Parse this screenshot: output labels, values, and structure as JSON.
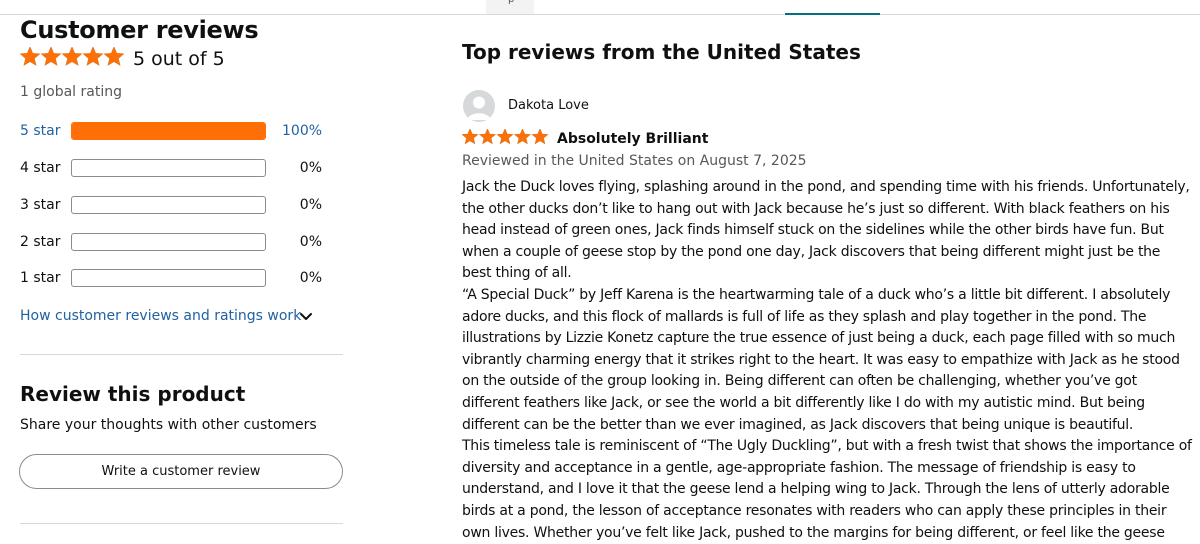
{
  "top_tabs": {
    "left_tab_label": "p"
  },
  "summary": {
    "title": "Customer reviews",
    "rating_value": 5,
    "rating_text": "5 out of 5",
    "total_ratings": "1 global rating",
    "histogram": [
      {
        "label": "5 star",
        "percent_text": "100%",
        "fraction": 1.0
      },
      {
        "label": "4 star",
        "percent_text": "0%",
        "fraction": 0
      },
      {
        "label": "3 star",
        "percent_text": "0%",
        "fraction": 0
      },
      {
        "label": "2 star",
        "percent_text": "0%",
        "fraction": 0
      },
      {
        "label": "1 star",
        "percent_text": "0%",
        "fraction": 0
      }
    ],
    "how_link": "How customer reviews and ratings work"
  },
  "review_product": {
    "title": "Review this product",
    "subtitle": "Share your thoughts with other customers",
    "button_label": "Write a customer review"
  },
  "top_reviews": {
    "heading": "Top reviews from the United States",
    "reviews": [
      {
        "reviewer": "Dakota Love",
        "stars": 5,
        "title": "Absolutely Brilliant",
        "date": "Reviewed in the United States on August 7, 2025",
        "paragraphs": [
          "Jack the Duck loves flying, splashing around in the pond, and spending time with his friends. Unfortunately, the other ducks don’t like to hang out with Jack because he’s just so different. With black feathers on his head instead of green ones, Jack finds himself stuck on the sidelines while the other birds have fun. But when a couple of geese stop by the pond one day, Jack discovers that being different might just be the best thing of all.",
          "“A Special Duck” by Jeff Karena is the heartwarming tale of a duck who’s a little bit different. I absolutely adore ducks, and this flock of mallards is full of life as they splash and play together in the pond. The illustrations by Lizzie Konetz capture the true essence of just being a duck, each page filled with so much vibrantly charming energy that it strikes right to the heart. It was easy to empathize with Jack as he stood on the outside of the group looking in. Being different can often be challenging, whether you’ve got different feathers like Jack, or see the world a bit differently like I do with my autistic mind. But being different can be the better than we ever imagined, as Jack discovers that being unique is beautiful.",
          "This timeless tale is reminiscent of “The Ugly Duckling”, but with a fresh twist that shows the importance of diversity and acceptance in a gentle, age-appropriate fashion. The message of friendship is easy to understand, and I love it that the geese lend a helping wing to Jack. Through the lens of utterly adorable birds at a pond, the lesson of acceptance resonates with readers who can apply these principles in their own lives. Whether you’ve felt like Jack, pushed to the margins for being different, or feel like the geese"
        ]
      }
    ]
  },
  "colors": {
    "star": "#ff6f06",
    "bar_fill": "#ff6f06",
    "link": "#2162a1",
    "text": "#0f1111",
    "muted": "#565959",
    "divider": "#d5d9d9"
  },
  "icons": {
    "star": "star-icon",
    "avatar": "user-avatar-icon",
    "chevron": "chevron-down-icon"
  }
}
